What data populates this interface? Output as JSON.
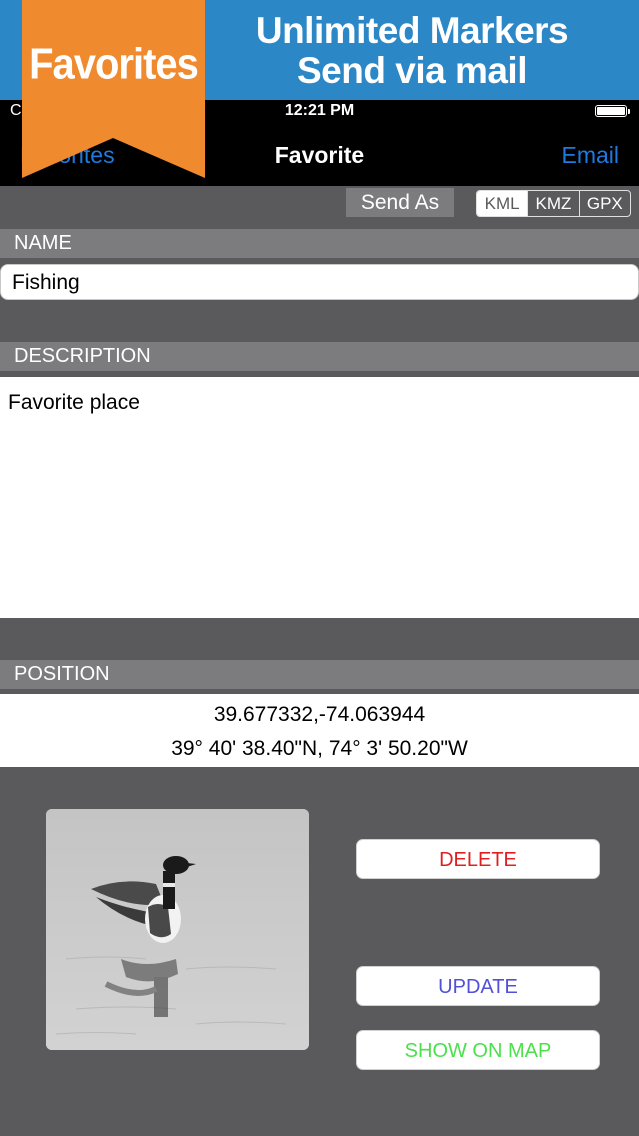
{
  "promo": {
    "line1": "Unlimited Markers",
    "line2": "Send via mail",
    "ribbon_label": "Favorites",
    "banner_color": "#2b87c6",
    "ribbon_color": "#f08a2e"
  },
  "status_bar": {
    "carrier": "C",
    "time": "12:21 PM"
  },
  "nav": {
    "back_label": "Favorites",
    "title": "Favorite",
    "right_label": "Email",
    "accent_color": "#1f7ae0"
  },
  "send_as": {
    "label": "Send As",
    "options": [
      "KML",
      "KMZ",
      "GPX"
    ],
    "selected": "KML"
  },
  "name_section": {
    "header": "NAME",
    "value": "Fishing"
  },
  "description_section": {
    "header": "DESCRIPTION",
    "value": "Favorite place"
  },
  "position_section": {
    "header": "POSITION",
    "decimal": "39.677332,-74.063944",
    "dms": "39° 40' 38.40\"N, 74° 3' 50.20\"W"
  },
  "actions": {
    "delete_label": "DELETE",
    "update_label": "UPDATE",
    "show_on_map_label": "SHOW ON MAP"
  }
}
